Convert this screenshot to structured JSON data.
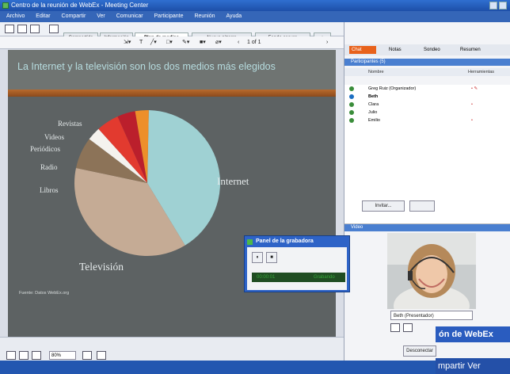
{
  "window": {
    "title": "Centro de la reunión de WebEx - Meeting Center"
  },
  "menu": [
    "Archivo",
    "Editar",
    "Compartir",
    "Ver",
    "Comunicar",
    "Participante",
    "Reunión",
    "Ayuda"
  ],
  "tabs": [
    {
      "label": "Compartido"
    },
    {
      "label": "Información"
    },
    {
      "label": "Plan de medios"
    },
    {
      "label": "Nueva pizarra"
    },
    {
      "label": "Fondo oscuro"
    }
  ],
  "page_indicator": "1 of 1",
  "slide": {
    "title": "La Internet y la televisión son los dos medios más elegidos",
    "source": "Fuente: Datos WebEx.org",
    "background": "#5d6263"
  },
  "chart_data": {
    "type": "pie",
    "labels": [
      "Internet",
      "Televisión",
      "Libros",
      "Radio",
      "Periódicos",
      "Videos",
      "Revistas"
    ],
    "values": [
      41,
      37,
      7,
      3,
      5,
      4,
      3
    ],
    "colors": [
      "#9fd1d3",
      "#c5ab95",
      "#8c7358",
      "#f4f2ee",
      "#e23a2f",
      "#bb1f2c",
      "#ed8f2a"
    ]
  },
  "zoom": "80%",
  "right_panel": {
    "toolbar_orange": "Chat",
    "toolbar_items": [
      "Notas",
      "Sondeo",
      "Resumen"
    ],
    "participants_header": "Participantes (5)",
    "columns": [
      "Nombre",
      "Herramientas"
    ],
    "participants": [
      {
        "name": "Greg Ruiz (Organizador)",
        "color": "#3a8d3a"
      },
      {
        "name": "Beth",
        "color": "#1b6ec2"
      },
      {
        "name": "Clara",
        "color": "#3a8d3a"
      },
      {
        "name": "Julio",
        "color": "#3a8d3a"
      },
      {
        "name": "Emilio",
        "color": "#3a8d3a"
      }
    ],
    "invite_button": "Invitar...",
    "video_header": "Video",
    "presenter": "Beth (Presentador)",
    "leave_button": "Desconectar"
  },
  "recorder": {
    "title": "Panel de la grabadora",
    "time": "00:00:01",
    "state": "Grabando"
  },
  "banner": {
    "line1": "ón de WebEx",
    "line2": "mpartir   Ver"
  }
}
